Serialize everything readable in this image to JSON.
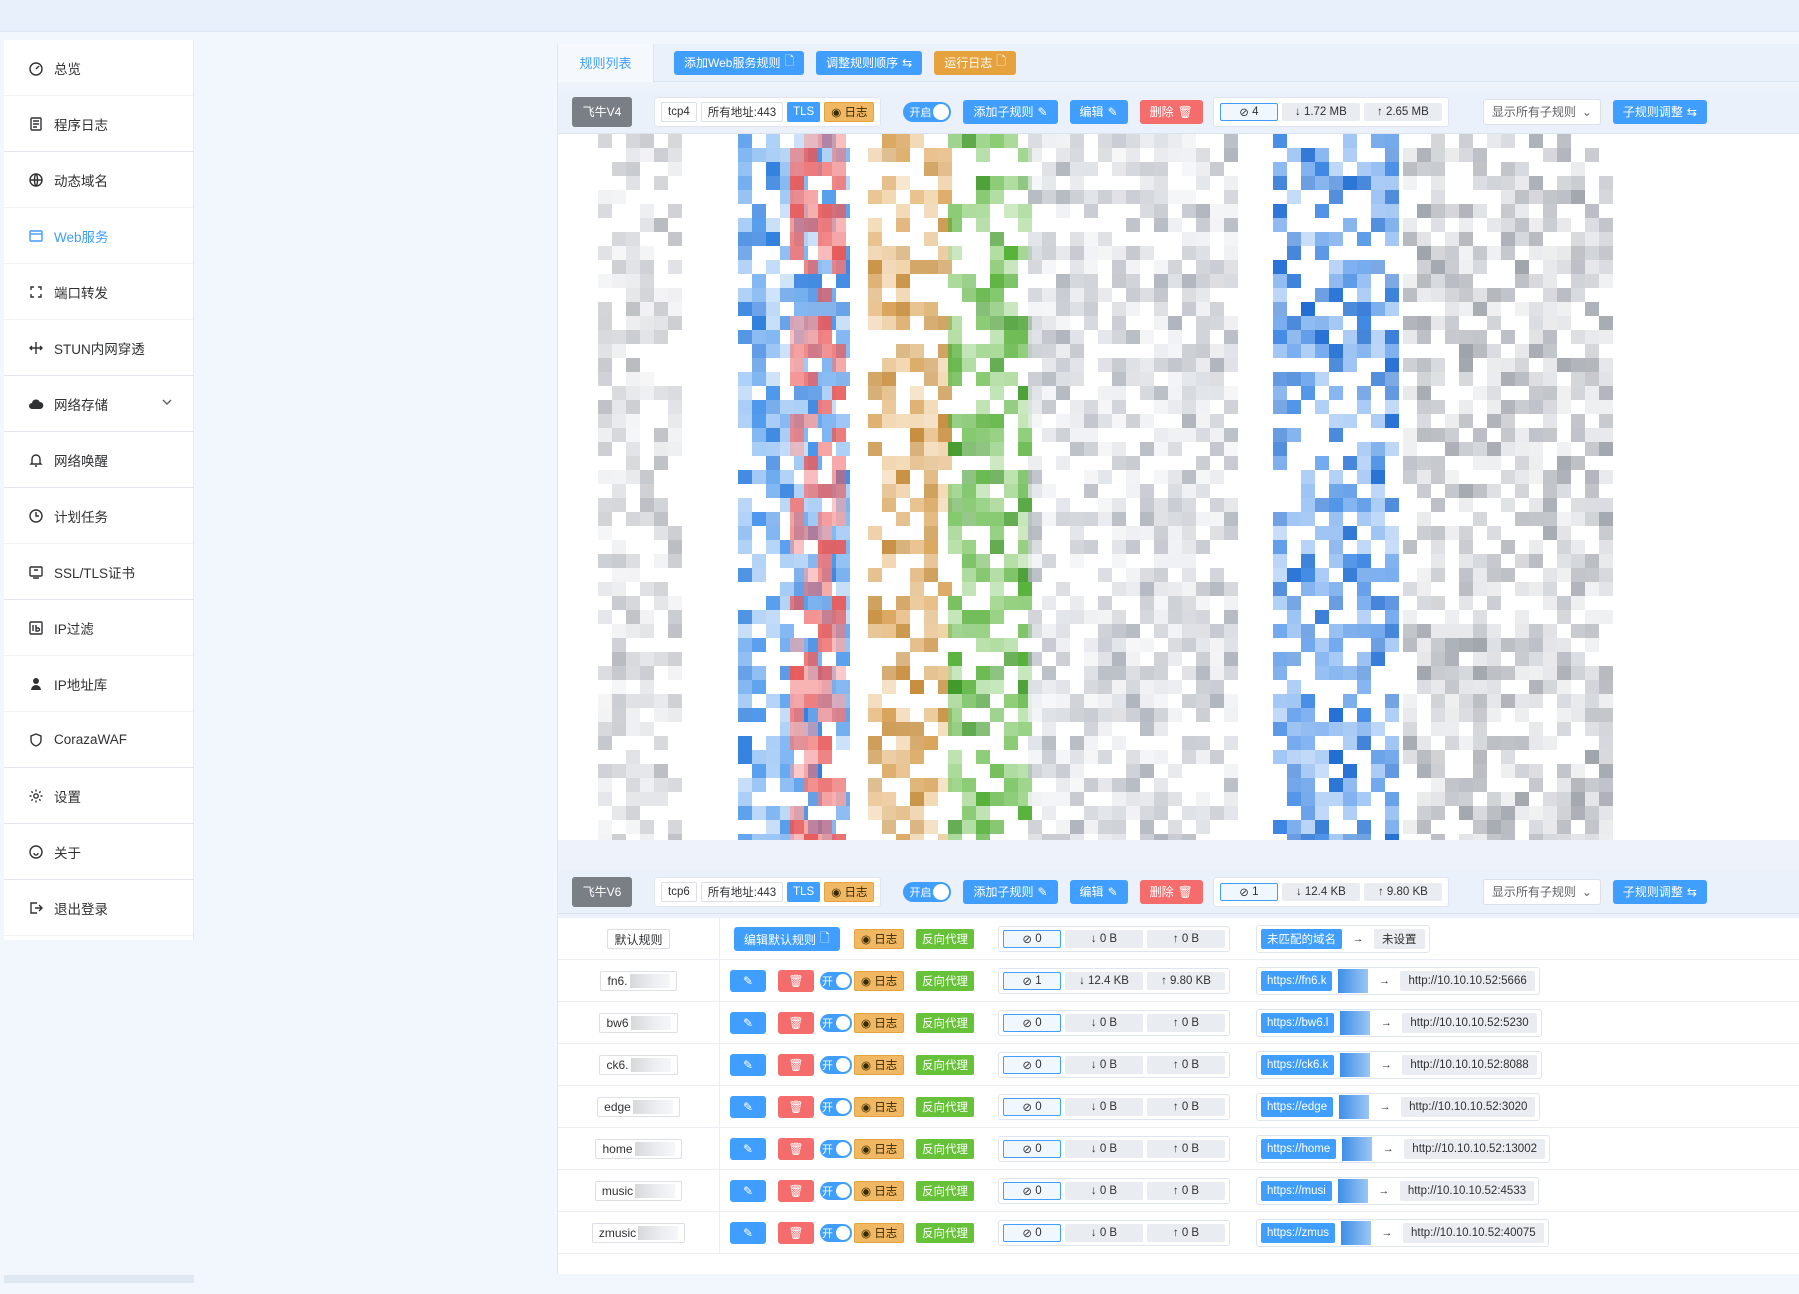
{
  "colors": {
    "accent": "#409eff",
    "warning": "#e6a23c",
    "danger": "#f56c6c",
    "success": "#67c23a"
  },
  "sidebar": {
    "items": [
      {
        "label": "总览",
        "icon": "dashboard-icon"
      },
      {
        "label": "程序日志",
        "icon": "log-icon"
      },
      {
        "label": "动态域名",
        "icon": "ddns-icon"
      },
      {
        "label": "Web服务",
        "icon": "web-icon",
        "active": true
      },
      {
        "label": "端口转发",
        "icon": "port-forward-icon"
      },
      {
        "label": "STUN内网穿透",
        "icon": "stun-icon"
      },
      {
        "label": "网络存储",
        "icon": "cloud-icon",
        "expandable": true
      },
      {
        "label": "网络唤醒",
        "icon": "bell-icon"
      },
      {
        "label": "计划任务",
        "icon": "clock-icon"
      },
      {
        "label": "SSL/TLS证书",
        "icon": "certificate-icon"
      },
      {
        "label": "IP过滤",
        "icon": "ip-filter-icon"
      },
      {
        "label": "IP地址库",
        "icon": "ip-db-icon"
      },
      {
        "label": "CorazaWAF",
        "icon": "shield-icon"
      },
      {
        "label": "设置",
        "icon": "gear-icon"
      },
      {
        "label": "关于",
        "icon": "about-icon"
      },
      {
        "label": "退出登录",
        "icon": "logout-icon"
      }
    ]
  },
  "tabbar": {
    "title": "规则列表",
    "add_rule": "添加Web服务规则",
    "reorder": "调整规则顺序",
    "run_log": "运行日志"
  },
  "rule_v4": {
    "name": "飞牛V4",
    "protocol": "tcp4",
    "address": "所有地址:443",
    "tls": "TLS",
    "log": "日志",
    "toggle": "开启",
    "add_sub": "添加子规则",
    "edit": "编辑",
    "delete": "删除",
    "connections": "4",
    "download": "1.72 MB",
    "upload": "2.65 MB",
    "show_sub": "显示所有子规则",
    "adjust_sub": "子规则调整"
  },
  "rule_v6": {
    "name": "飞牛V6",
    "protocol": "tcp6",
    "address": "所有地址:443",
    "tls": "TLS",
    "log": "日志",
    "toggle": "开启",
    "add_sub": "添加子规则",
    "edit": "编辑",
    "delete": "删除",
    "connections": "1",
    "download": "12.4 KB",
    "upload": "9.80 KB",
    "show_sub": "显示所有子规则",
    "adjust_sub": "子规则调整"
  },
  "default_rule": {
    "name": "默认规则",
    "edit_default": "编辑默认规则",
    "log": "日志",
    "proxy": "反向代理",
    "connections": "0",
    "download": "0 B",
    "upload": "0 B",
    "unmatched": "未匹配的域名",
    "arrow": "→",
    "unset": "未设置"
  },
  "sub_common": {
    "toggle": "开",
    "log": "日志",
    "proxy": "反向代理",
    "arrow": "→"
  },
  "sub_rules": [
    {
      "name": "fn6.",
      "connections": "1",
      "download": "12.4 KB",
      "upload": "9.80 KB",
      "domain": "https://fn6.k",
      "target": "http://10.10.10.52:5666"
    },
    {
      "name": "bw6",
      "connections": "0",
      "download": "0 B",
      "upload": "0 B",
      "domain": "https://bw6.l",
      "target": "http://10.10.10.52:5230"
    },
    {
      "name": "ck6.",
      "connections": "0",
      "download": "0 B",
      "upload": "0 B",
      "domain": "https://ck6.k",
      "target": "http://10.10.10.52:8088"
    },
    {
      "name": "edge",
      "connections": "0",
      "download": "0 B",
      "upload": "0 B",
      "domain": "https://edge",
      "target": "http://10.10.10.52:3020"
    },
    {
      "name": "home",
      "connections": "0",
      "download": "0 B",
      "upload": "0 B",
      "domain": "https://home",
      "target": "http://10.10.10.52:13002"
    },
    {
      "name": "music",
      "connections": "0",
      "download": "0 B",
      "upload": "0 B",
      "domain": "https://musi",
      "target": "http://10.10.10.52:4533"
    },
    {
      "name": "zmusic",
      "connections": "0",
      "download": "0 B",
      "upload": "0 B",
      "domain": "https://zmus",
      "target": "http://10.10.10.52:40075"
    }
  ]
}
